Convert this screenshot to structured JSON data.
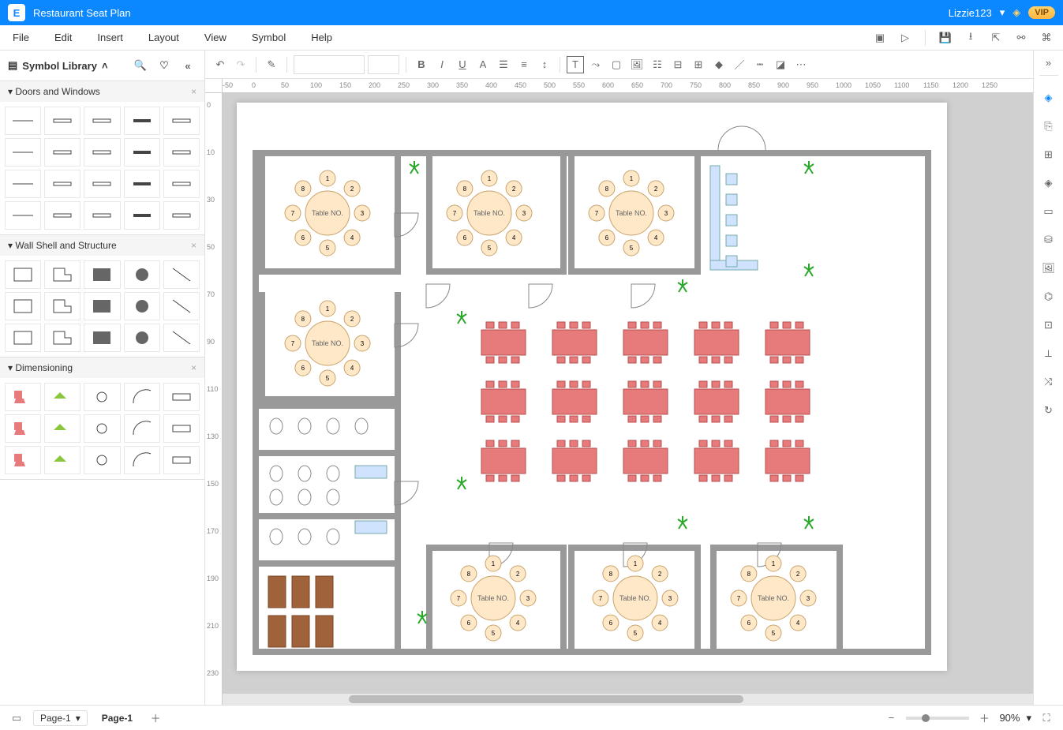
{
  "titlebar": {
    "app_logo": "E",
    "doc_title": "Restaurant Seat Plan",
    "username": "Lizzie123",
    "vip_label": "VIP"
  },
  "menubar": {
    "items": [
      "File",
      "Edit",
      "Insert",
      "Layout",
      "View",
      "Symbol",
      "Help"
    ]
  },
  "sidebar": {
    "title": "Symbol Library",
    "sections": [
      {
        "title": "Doors and Windows",
        "count": 20
      },
      {
        "title": "Wall Shell and Structure",
        "count": 15
      },
      {
        "title": "Dimensioning",
        "count": 15
      }
    ]
  },
  "toolbar": {
    "font_name": "",
    "font_size": ""
  },
  "canvas": {
    "ruler_h": [
      "-50",
      "0",
      "50",
      "100",
      "150",
      "200",
      "250",
      "300",
      "350",
      "400",
      "450",
      "500",
      "550",
      "600",
      "650",
      "700",
      "750",
      "800",
      "850",
      "900",
      "950",
      "1000",
      "1050",
      "1100",
      "1150",
      "1200",
      "1250"
    ],
    "ruler_v": [
      "0",
      "10",
      "30",
      "50",
      "70",
      "90",
      "110",
      "130",
      "150",
      "170",
      "190",
      "210",
      "230"
    ],
    "table_label": "Table NO.",
    "round_table_seats": [
      "1",
      "2",
      "3",
      "4",
      "5",
      "6",
      "7",
      "8"
    ],
    "round_tables_row1": 3,
    "round_tables_row2_left": 1,
    "rect_tables_rows": 3,
    "rect_tables_cols": 5,
    "round_tables_bottom": 3
  },
  "statusbar": {
    "page_dropdown": "Page-1",
    "page_tab": "Page-1",
    "zoom_label": "90%"
  },
  "colors": {
    "accent": "#0b88ff",
    "table_fill": "#ffe8c8",
    "chair_fill": "#ffe8c8",
    "rect_table": "#e77a7a",
    "plant": "#2aa82a",
    "wall": "#999"
  }
}
